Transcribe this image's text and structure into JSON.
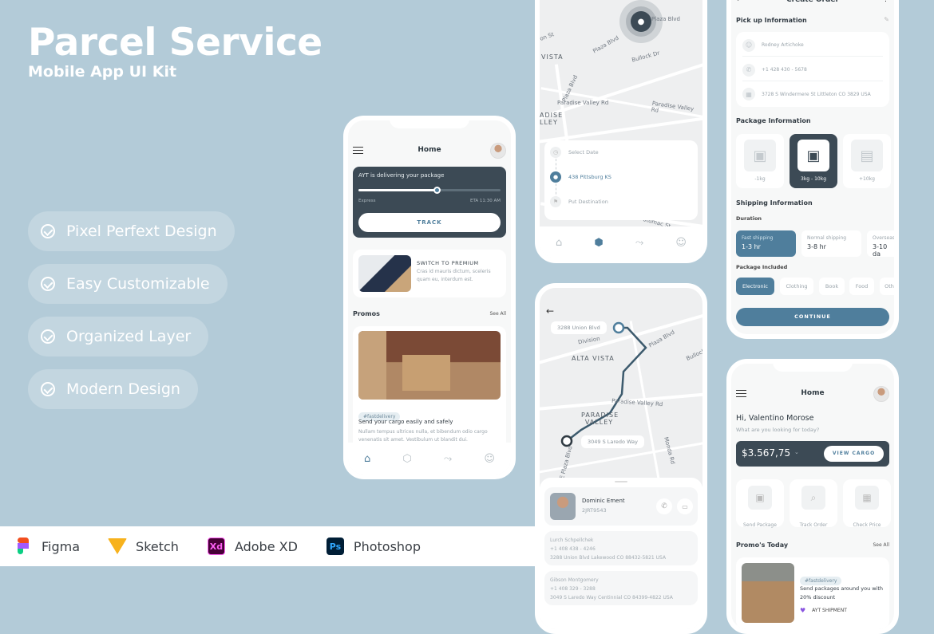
{
  "hero": {
    "title": "Parcel Service",
    "subtitle": "Mobile App UI Kit"
  },
  "features": [
    "Pixel Perfext Design",
    "Easy Customizable",
    "Organized Layer",
    "Modern Design"
  ],
  "tools": [
    {
      "name": "Figma",
      "icon": "figma-logo"
    },
    {
      "name": "Sketch",
      "icon": "sketch-logo"
    },
    {
      "name": "Adobe XD",
      "icon": "xd-logo",
      "glyph": "Xd"
    },
    {
      "name": "Photoshop",
      "icon": "ps-logo",
      "glyph": "Ps"
    }
  ],
  "phone_home1": {
    "title": "Home",
    "delivery": {
      "text": "AYT is delivering your package",
      "progress": 0.55,
      "left": "Express",
      "right": "ETA 11:30 AM",
      "button": "TRACK"
    },
    "premium": {
      "title": "SWITCH TO PREMIUM",
      "desc": "Cras id mauris dictum, sceleris quam eu, interdum est."
    },
    "promos": {
      "title": "Promos",
      "see_all": "See All",
      "tag": "#fastdelivery",
      "headline": "Send your cargo easily and safely",
      "desc": "Nullam tempus ultrices nulla, et bibendum odio cargo venenatis sit amet. Vestibulum ut blandit dui."
    },
    "nav": [
      "home",
      "package",
      "route",
      "profile"
    ]
  },
  "phone_map1": {
    "labels": [
      "Plaza Blvd",
      "Plaza Blvd",
      "Bullock Dr",
      "VISTA",
      "Plaza Blvd",
      "Paradise Valley Rd",
      "Paradise Valley Rd",
      "ADISE LLEY",
      "Potomac St",
      "on St"
    ],
    "steps": [
      {
        "label": "Select Date",
        "icon": "clock-icon",
        "active": false
      },
      {
        "label": "438 Pittsburg KS",
        "icon": "pin-icon",
        "active": true
      },
      {
        "label": "Put Destination",
        "icon": "flag-icon",
        "active": false
      }
    ]
  },
  "phone_route": {
    "origin": "3288 Union Blvd",
    "destination": "3049 S Laredo Way",
    "labels": {
      "area1": "ALTA VISTA",
      "area2": "PARADISE VALLEY",
      "r1": "Plaza Blvd",
      "r2": "Bullock",
      "r3": "Paradise Valley Rd",
      "r4": "Division",
      "r5": "Monda Rd",
      "r6": "E Plaza Blvd"
    },
    "courier": {
      "name": "Dominic Ement",
      "id": "2JRT9543"
    },
    "sender": {
      "name": "Lurch Schpellchek",
      "phone": "+1 408 438 - 4246",
      "address": "3288 Union Blvd Lakewood CO 88432-5821 USA"
    },
    "receiver": {
      "name": "Gibson Montgomery",
      "phone": "+1 408 329 - 3288",
      "address": "3049 S Laredo Way Centinnial CO 84399-4822 USA"
    }
  },
  "phone_order": {
    "title": "Create Order",
    "pickup": {
      "title": "Pick up Information",
      "name": "Rodney Artichoke",
      "phone": "+1 428 430 - 5678",
      "address": "3728 S Windermere St Littleton CO 3829 USA"
    },
    "package": {
      "title": "Package Information",
      "options": [
        {
          "label": "-1kg",
          "selected": false
        },
        {
          "label": "3kg - 10kg",
          "selected": true
        },
        {
          "label": "+10kg",
          "selected": false
        }
      ]
    },
    "shipping": {
      "title": "Shipping Information",
      "duration_label": "Duration",
      "options": [
        {
          "name": "Fast shipping",
          "time": "1-3 hr",
          "selected": true
        },
        {
          "name": "Normal shipping",
          "time": "3-8 hr",
          "selected": false
        },
        {
          "name": "Overseas",
          "time": "3-10 da",
          "selected": false
        }
      ]
    },
    "included": {
      "title": "Package Included",
      "options": [
        {
          "label": "Electronic",
          "selected": true
        },
        {
          "label": "Clothing",
          "selected": false
        },
        {
          "label": "Book",
          "selected": false
        },
        {
          "label": "Food",
          "selected": false
        },
        {
          "label": "Oth",
          "selected": false
        }
      ]
    },
    "continue": "CONTINUE"
  },
  "phone_home2": {
    "title": "Home",
    "greeting": "Hi, Valentino Morose",
    "prompt": "What are you looking for today?",
    "balance": "$3.567,75",
    "view_cargo": "VIEW CARGO",
    "actions": [
      "Send Package",
      "Track Order",
      "Check Price"
    ],
    "promo_title": "Promo's Today",
    "see_all": "See All",
    "promo": {
      "tag": "#fastdelivery",
      "headline": "Send packages around you with 20% discount",
      "brand": "AYT SHIPMENT"
    }
  }
}
